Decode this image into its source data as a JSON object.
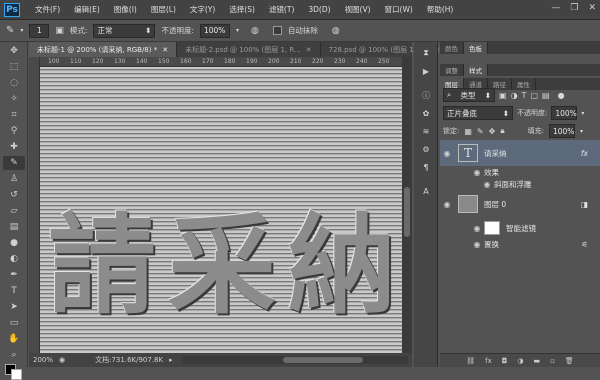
{
  "menu": [
    "文件(F)",
    "编辑(E)",
    "图像(I)",
    "图层(L)",
    "文字(Y)",
    "选择(S)",
    "滤镜(T)",
    "3D(D)",
    "视图(V)",
    "窗口(W)",
    "帮助(H)"
  ],
  "options": {
    "size": "1",
    "mode_label": "模式:",
    "mode_value": "正常",
    "opacity_label": "不透明度:",
    "opacity_value": "100%",
    "auto_erase": "自动抹除"
  },
  "doc_tabs": [
    "未标题-1 @ 200% (请采纳, RGB/8) *",
    "未标题-2.psd @ 100% (图层 1, R...",
    "728.psd @ 100% (图层 1, R..."
  ],
  "ruler_marks": [
    "100",
    "110",
    "120",
    "130",
    "140",
    "150",
    "160",
    "170",
    "180",
    "190",
    "200",
    "210",
    "220",
    "230",
    "240",
    "250"
  ],
  "canvas_text": [
    "請",
    "采",
    "納"
  ],
  "status": {
    "zoom": "200%",
    "doc": "文档:731.6K/907.8K"
  },
  "panel": {
    "top_tabs": [
      "颜色",
      "色板"
    ],
    "mid_tabs": [
      "调整",
      "样式"
    ],
    "layer_tabs": [
      "图层",
      "通道",
      "路径",
      "属性"
    ],
    "kind": "类型",
    "blend": "正片叠底",
    "opacity_label": "不透明度:",
    "opacity": "100%",
    "lock_label": "锁定:",
    "fill_label": "填充:",
    "fill": "100%",
    "layers": [
      {
        "name": "请采纳",
        "fx": "fx"
      },
      {
        "name": "效果"
      },
      {
        "name": "斜面和浮雕"
      },
      {
        "name": "图层 0"
      },
      {
        "name": "智能滤镜"
      },
      {
        "name": "置换"
      }
    ]
  },
  "accent": "#31a8ff"
}
